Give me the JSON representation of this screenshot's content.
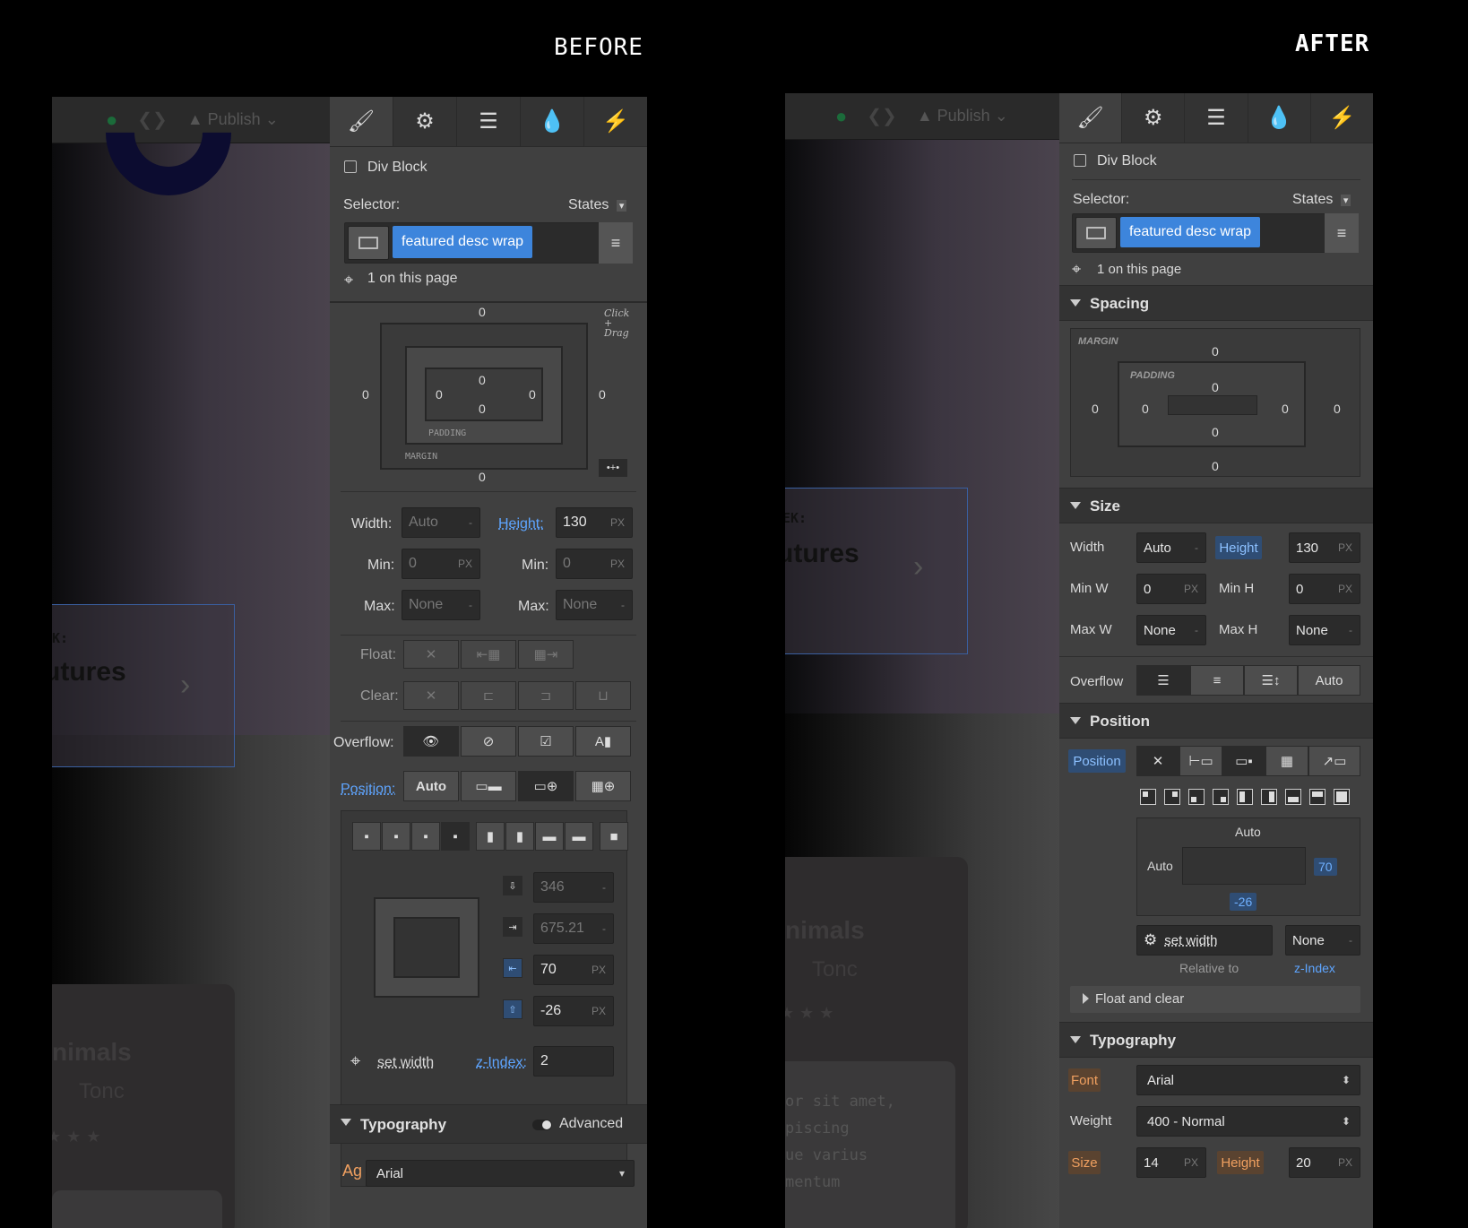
{
  "headings": {
    "before": "BEFORE",
    "after": "AFTER"
  },
  "background": {
    "publish": "Publish",
    "card_kicker": "EK:",
    "card_title": "utures",
    "card2_title": "nimals",
    "card2_sub": "Tonc",
    "code_lines": [
      "or sit amet,",
      "piscing",
      "ue varius",
      "mentum"
    ]
  },
  "tabs": [
    {
      "name": "style",
      "icon": "paintbrush-icon"
    },
    {
      "name": "settings",
      "icon": "gear-icon"
    },
    {
      "name": "navigator",
      "icon": "menu-lines-icon"
    },
    {
      "name": "interactions",
      "icon": "drops-icon"
    },
    {
      "name": "actions",
      "icon": "lightning-icon"
    }
  ],
  "before": {
    "element": "Div Block",
    "selector_label": "Selector:",
    "states": "States",
    "class": "featured desc wrap",
    "on_page": "1 on this page",
    "box_model": {
      "margin_top": "0",
      "margin_bottom": "0",
      "margin_left": "0",
      "margin_right": "0",
      "padding_top": "0",
      "padding_bottom": "0",
      "padding_left": "0",
      "padding_right": "0",
      "padding_label": "PADDING",
      "margin_label": "MARGIN",
      "hint": "Click + Drag"
    },
    "size": {
      "width_label": "Width:",
      "width": "Auto",
      "height_label": "Height:",
      "height": "130",
      "unit": "PX",
      "min_label": "Min:",
      "min_w": "0",
      "min_h": "0",
      "max_label": "Max:",
      "max_w": "None",
      "max_h": "None",
      "dash": "-"
    },
    "float_label": "Float:",
    "clear_label": "Clear:",
    "overflow_label": "Overflow:",
    "position_label": "Position:",
    "position_auto": "Auto",
    "pos_values": {
      "top": "346",
      "left": "675.21",
      "right": "70",
      "bottom": "-26",
      "unit": "PX",
      "dash": "-"
    },
    "set_width": "set width",
    "zindex_label": "z-Index:",
    "zindex": "2",
    "typography": "Typography",
    "advanced": "Advanced",
    "font": "Arial"
  },
  "after": {
    "element": "Div Block",
    "selector_label": "Selector:",
    "states": "States",
    "class": "featured desc wrap",
    "on_page": "1 on this page",
    "spacing": "Spacing",
    "margin_label": "MARGIN",
    "padding_label": "PADDING",
    "margin": {
      "top": "0",
      "bottom": "0",
      "left": "0",
      "right": "0"
    },
    "padding": {
      "top": "0",
      "bottom": "0",
      "left": "0",
      "right": "0"
    },
    "size_title": "Size",
    "size": {
      "width_label": "Width",
      "width": "Auto",
      "height_label": "Height",
      "height": "130",
      "unit": "PX",
      "min_w_label": "Min W",
      "min_w": "0",
      "min_h_label": "Min H",
      "min_h": "0",
      "max_w_label": "Max W",
      "max_w": "None",
      "max_h_label": "Max H",
      "max_h": "None",
      "dash": "-"
    },
    "overflow_label": "Overflow",
    "overflow_auto": "Auto",
    "position_title": "Position",
    "position_tag": "Position",
    "pos_values": {
      "top": "Auto",
      "left": "Auto",
      "right": "70",
      "bottom": "-26"
    },
    "set_width": "set width",
    "zindex_value": "None",
    "relative_to": "Relative to",
    "zindex_label": "z-Index",
    "float_clear": "Float and clear",
    "typography": "Typography",
    "font_label": "Font",
    "font": "Arial",
    "weight_label": "Weight",
    "weight": "400 - Normal",
    "size_label": "Size",
    "font_size": "14",
    "lh_label": "Height",
    "line_height": "20",
    "unit": "PX"
  }
}
